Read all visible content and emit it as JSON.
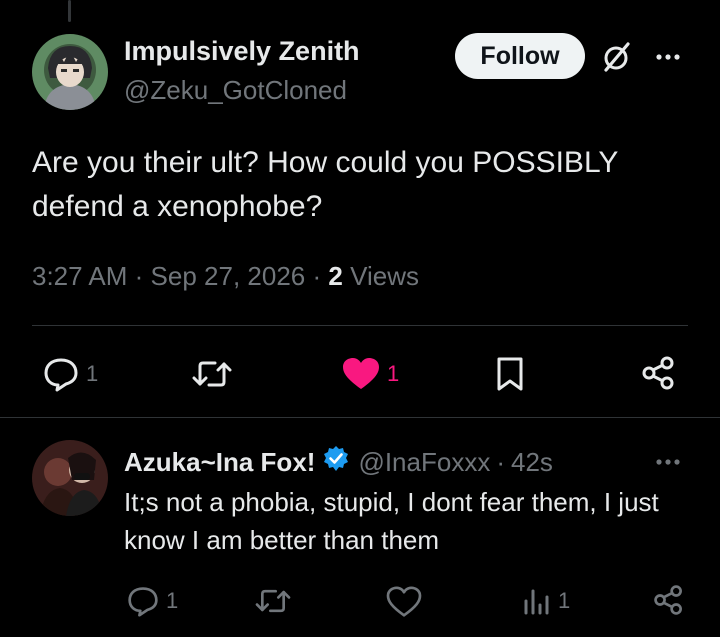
{
  "tweet": {
    "author_name": "Impulsively Zenith",
    "author_handle": "@Zeku_GotCloned",
    "follow_label": "Follow",
    "text": "Are you their ult? How could you POSSIBLY defend a xenophobe?",
    "time": "3:27 AM",
    "date": "Sep 27, 2026",
    "separator": "·",
    "views_count": "2",
    "views_label": "Views",
    "actions": {
      "reply_count": "1",
      "retweet_count": "",
      "like_count": "1",
      "liked": true
    }
  },
  "reply": {
    "author_name": "Azuka~Ina Fox!",
    "verified": true,
    "author_handle": "@InaFoxxx",
    "separator": "·",
    "age": "42s",
    "text": "It;s not a phobia, stupid, I dont fear them, I just know I am better than them",
    "actions": {
      "reply_count": "1",
      "views_count": "1"
    }
  },
  "icons": {
    "grok": "grok-slash-icon",
    "more": "more-dots-icon",
    "reply": "speech-bubble-icon",
    "retweet": "retweet-arrows-icon",
    "like": "heart-icon",
    "bookmark": "bookmark-icon",
    "share": "share-nodes-icon",
    "views": "bar-chart-icon",
    "verified": "verified-badge-icon"
  },
  "colors": {
    "background": "#000000",
    "text_primary": "#e7e9ea",
    "text_secondary": "#71767b",
    "divider": "#2f3336",
    "like_pink": "#f91880",
    "verified_blue": "#1d9bf0",
    "follow_bg": "#eff3f4"
  }
}
